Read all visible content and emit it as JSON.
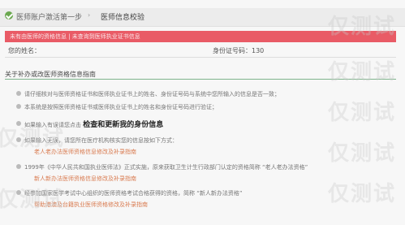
{
  "header": {
    "step1": "医师账户激活第一步",
    "step2": "医师信息校验"
  },
  "alert": {
    "text": "未有由医师的资格信息 | 未查询到医师执业证书信息"
  },
  "form": {
    "name_label": "您的姓名：",
    "id_label": "身份证号码：130"
  },
  "section": {
    "title": "关于补办或改医师资格信息指南"
  },
  "paragraphs": [
    "请仔细核对与医师资格证书和医师执业证书上的姓名、身份证号码与系统中您所输入的信息是否一致；",
    "本系统是按照医师资格证书或医师执业证书上的姓名和身份证号码进行验证；",
    "如果输入有误请您点击",
    "如果输入无误，请您所在医疗机构核实您的信息按如下方式：",
    "1999年《中华人民共和国执业医师法》正式实施，原来获取卫生计生行政部门认定的资格简称 “老人老办法资格”",
    "经参加国家医学考试中心组织的医师资格考试合格获得的资格，简称 “新人新办法资格”"
  ],
  "emphasis": {
    "check_update": "检查和更新我的身份信息"
  },
  "links": {
    "link1": "老人老办法医师资格信息修改及补录指南",
    "link2": "新人新办法医师资格信息修改及补录指南",
    "link3": "帮助港澳及台籍执业医师资格修改及补录指南"
  },
  "watermark": {
    "text": "仅测试"
  },
  "colors": {
    "alert_bg": "#e95b66",
    "link": "#d97b50",
    "section_line": "#7fb48c"
  }
}
